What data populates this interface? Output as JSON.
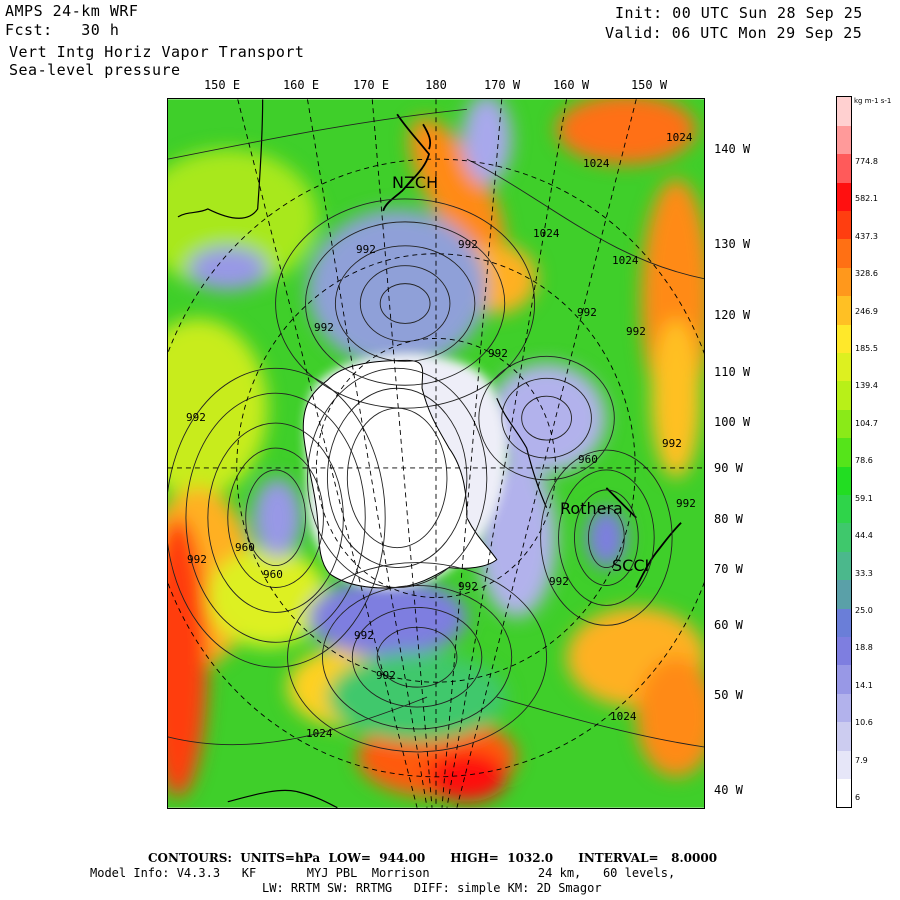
{
  "header": {
    "model": "AMPS 24-km WRF",
    "fcst": "Fcst:   30 h",
    "field1": "Vert Intg Horiz Vapor Transport",
    "field2": "Sea-level pressure",
    "init": "Init: 00 UTC Sun 28 Sep 25",
    "valid": "Valid: 06 UTC Mon 29 Sep 25"
  },
  "longitude_labels": [
    "150 E",
    "160 E",
    "170 E",
    "180",
    "170 W",
    "160 W",
    "150 W"
  ],
  "latitude_labels": [
    "140 W",
    "130 W",
    "120 W",
    "110 W",
    "100 W",
    "90 W",
    "80 W",
    "70 W",
    "60 W",
    "50 W",
    "40 W"
  ],
  "stations": [
    "NZCH",
    "Rothera",
    "SCCI"
  ],
  "pressure_labels": [
    "1024",
    "1024",
    "1024",
    "1024",
    "1024",
    "1024",
    "992",
    "992",
    "992",
    "992",
    "992",
    "992",
    "992",
    "992",
    "992",
    "992",
    "992",
    "992",
    "992",
    "992",
    "960",
    "960",
    "960"
  ],
  "colorbar": {
    "units": "kg m-1 s-1",
    "ticks": [
      "774.8",
      "582.1",
      "437.3",
      "328.6",
      "246.9",
      "185.5",
      "139.4",
      "104.7",
      "78.6",
      "59.1",
      "44.4",
      "33.3",
      "25.0",
      "18.8",
      "14.1",
      "10.6",
      "7.9",
      "6"
    ],
    "colors": [
      "#ffffff",
      "#e6e6f8",
      "#ccccf0",
      "#b2b2ec",
      "#9898e6",
      "#7e7ee0",
      "#6a7ed8",
      "#5aa0a8",
      "#4bb88c",
      "#3fc86c",
      "#2fd44a",
      "#22dd22",
      "#55e41a",
      "#8aea18",
      "#b8f018",
      "#ddf020",
      "#ffe82a",
      "#ffc024",
      "#ff981c",
      "#ff7014",
      "#ff3e10",
      "#ff1010",
      "#ff5a5a",
      "#ff9a9a",
      "#ffd0d0"
    ]
  },
  "footer": {
    "contours": "CONTOURS:  UNITS=hPa  LOW=  944.00      HIGH=  1032.0      INTERVAL=   8.0000",
    "model_info": "Model Info: V4.3.3   KF       MYJ PBL  Morrison               24 km,   60 levels,",
    "physics": "LW: RRTM SW: RRTMG   DIFF: simple KM: 2D Smagor"
  }
}
